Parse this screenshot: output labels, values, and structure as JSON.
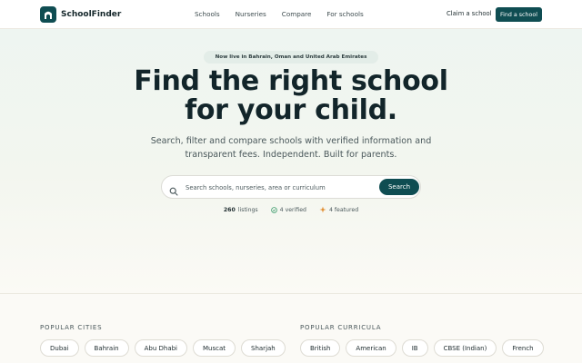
{
  "brand": {
    "name": "SchoolFinder"
  },
  "nav": {
    "links": [
      "Schools",
      "Nurseries",
      "Compare",
      "For schools"
    ],
    "claim_label": "Claim a school",
    "cta_label": "Find a school"
  },
  "hero": {
    "badge": "Now live in Bahrain, Oman and United Arab Emirates",
    "headline_line1": "Find the right school",
    "headline_line2": "for your child.",
    "sub_line1": "Search, filter and compare schools with verified information and",
    "sub_line2": "transparent fees. Independent. Built for parents."
  },
  "search": {
    "placeholder": "Search schools, nurseries, area or curriculum",
    "button_label": "Search"
  },
  "stats": {
    "listings_count": "260",
    "listings_label": "listings",
    "verified": "4 verified",
    "featured": "4 featured"
  },
  "popular_cities": {
    "heading": "POPULAR CITIES",
    "items": [
      "Dubai",
      "Bahrain",
      "Abu Dhabi",
      "Muscat",
      "Sharjah"
    ]
  },
  "popular_curricula": {
    "heading": "POPULAR CURRICULA",
    "items": [
      "British",
      "American",
      "IB",
      "CBSE (Indian)",
      "French"
    ]
  },
  "colors": {
    "brand": "#0f4d52",
    "verified": "#3a9a6a",
    "featured": "#e08a2a"
  }
}
